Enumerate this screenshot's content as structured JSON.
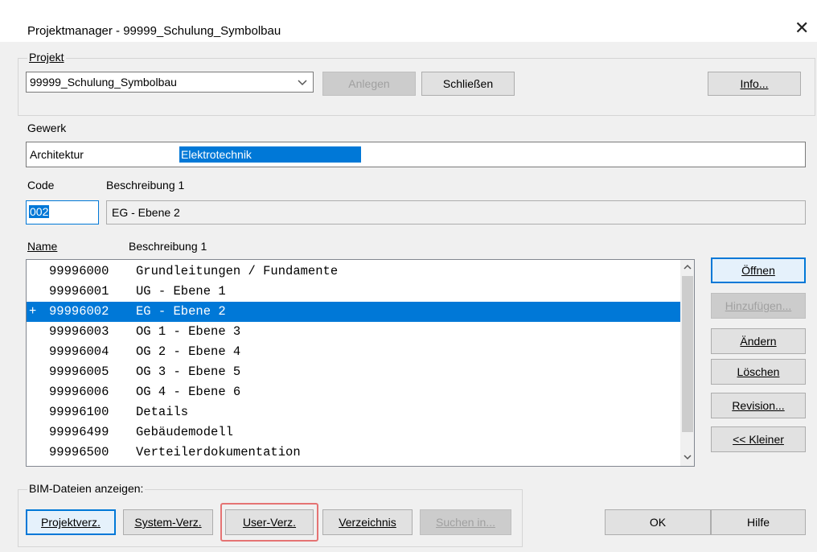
{
  "window": {
    "title": "Projektmanager - 99999_Schulung_Symbolbau"
  },
  "projekt": {
    "group_label": "Projekt",
    "combo_value": "99999_Schulung_Symbolbau",
    "anlegen_label": "Anlegen",
    "schliessen_label": "Schließen",
    "info_label": "Info..."
  },
  "gewerk": {
    "label": "Gewerk",
    "items": [
      "Architektur",
      "Elektrotechnik"
    ],
    "selected": "Elektrotechnik"
  },
  "code": {
    "code_label": "Code",
    "desc_label": "Beschreibung 1",
    "code_value": "002",
    "desc_value": "EG - Ebene 2"
  },
  "list": {
    "name_header": "Name",
    "desc_header": "Beschreibung 1",
    "rows": [
      {
        "prefix": "",
        "name": "99996000",
        "desc": "Grundleitungen / Fundamente"
      },
      {
        "prefix": "",
        "name": "99996001",
        "desc": "UG - Ebene 1"
      },
      {
        "prefix": "+",
        "name": "99996002",
        "desc": "EG - Ebene 2"
      },
      {
        "prefix": "",
        "name": "99996003",
        "desc": "OG 1 - Ebene 3"
      },
      {
        "prefix": "",
        "name": "99996004",
        "desc": "OG 2 - Ebene 4"
      },
      {
        "prefix": "",
        "name": "99996005",
        "desc": "OG 3 - Ebene 5"
      },
      {
        "prefix": "",
        "name": "99996006",
        "desc": "OG 4 - Ebene 6"
      },
      {
        "prefix": "",
        "name": "99996100",
        "desc": "Details"
      },
      {
        "prefix": "",
        "name": "99996499",
        "desc": "Gebäudemodell"
      },
      {
        "prefix": "",
        "name": "99996500",
        "desc": "Verteilerdokumentation"
      }
    ],
    "selected_index": 2
  },
  "side_buttons": {
    "oeffnen": "Öffnen",
    "hinzufuegen": "Hinzufügen...",
    "aendern": "Ändern",
    "loeschen": "Löschen",
    "revision": "Revision...",
    "kleiner": "<< Kleiner"
  },
  "bim": {
    "label": "BIM-Dateien anzeigen:",
    "projektverz": "Projektverz.",
    "systemverz": "System-Verz.",
    "userverz": "User-Verz.",
    "verzeichnis": "Verzeichnis",
    "suchen": "Suchen in..."
  },
  "footer": {
    "ok": "OK",
    "hilfe": "Hilfe"
  },
  "colors": {
    "accent": "#0078d7",
    "highlight_border": "#e57373"
  }
}
